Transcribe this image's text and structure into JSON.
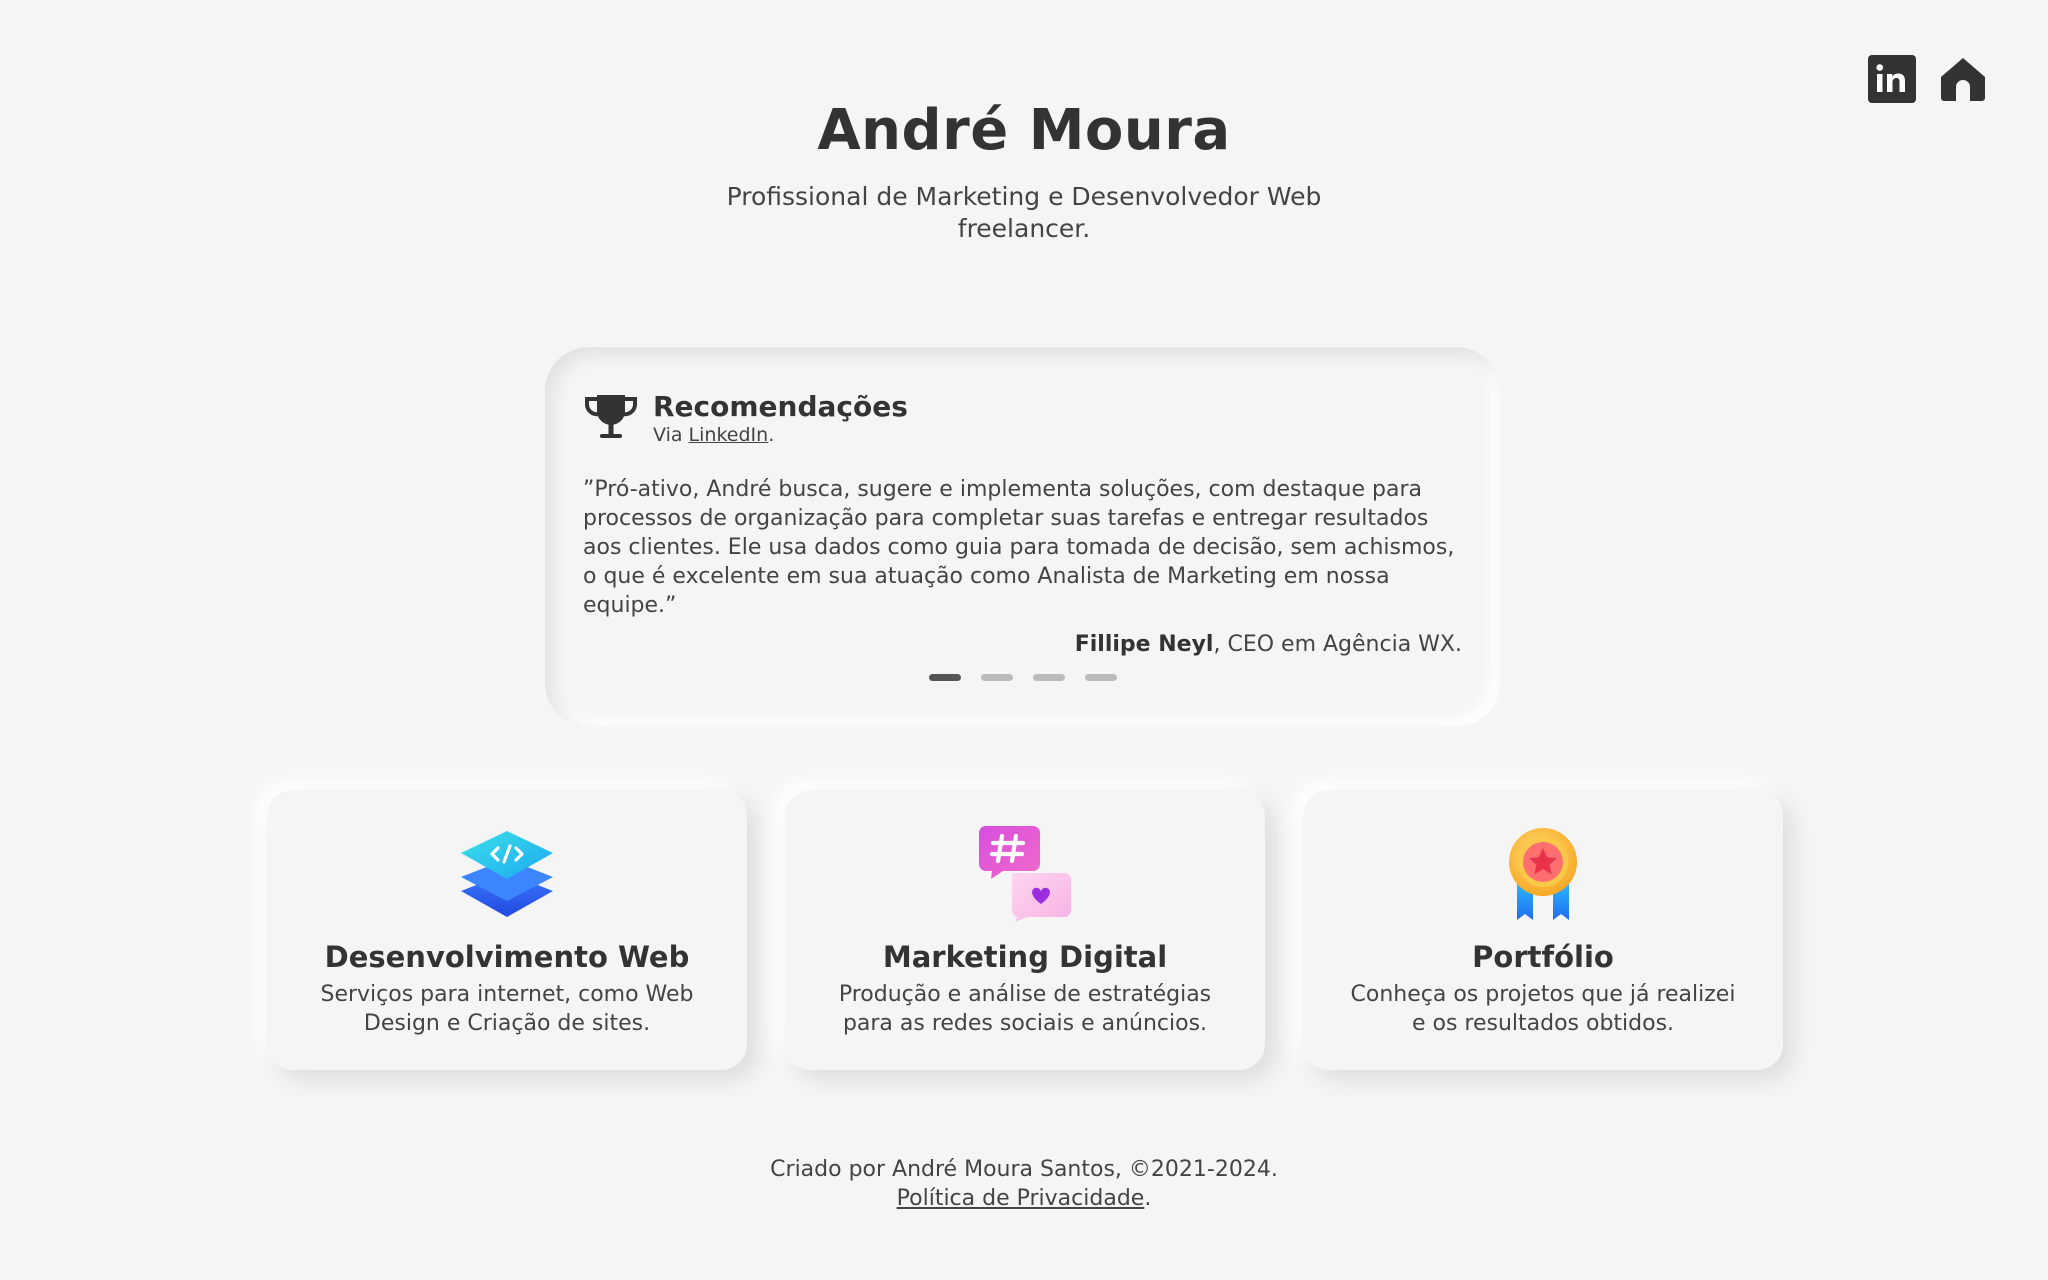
{
  "header": {
    "name": "André Moura",
    "tagline": "Profissional de Marketing e Desenvolvedor Web freelancer."
  },
  "top_icons": [
    {
      "icon": "linkedin-icon",
      "color": "#333333"
    },
    {
      "icon": "home-icon",
      "color": "#333333"
    }
  ],
  "recommendations": {
    "title": "Recomendações",
    "via_prefix": "Via ",
    "via_link": "LinkedIn",
    "via_suffix": ".",
    "quote": "”Pró-ativo, André busca, sugere e implementa soluções, com destaque para processos de organização para completar suas tarefas e entregar resultados aos clientes. Ele usa dados como guia para tomada de decisão, sem achismos, o que é excelente em sua atuação como Analista de Marketing em nossa equipe.”",
    "author_name": "Fillipe Neyl",
    "author_role": ", CEO em Agência WX.",
    "active_slide": 1,
    "slide_count": 4
  },
  "cards": [
    {
      "title": "Desenvolvimento Web",
      "desc": "Serviços para internet, como Web Design e Criação de sites.",
      "icon": "web-dev-icon"
    },
    {
      "title": "Marketing Digital",
      "desc": "Produção e análise de estratégias para as redes sociais e anúncios.",
      "icon": "social-media-icon"
    },
    {
      "title": "Portfólio",
      "desc": "Conheça os projetos que já realizei e os resultados obtidos.",
      "icon": "medal-icon"
    }
  ],
  "footer": {
    "credit": "Criado por André Moura Santos, ©2021-2024.",
    "privacy_link": "Política de Privacidade",
    "privacy_suffix": "."
  },
  "colors": {
    "background": "#f5f5f5",
    "text": "#333333",
    "dot_active": "#555555",
    "dot_inactive": "#bbbbbb"
  }
}
